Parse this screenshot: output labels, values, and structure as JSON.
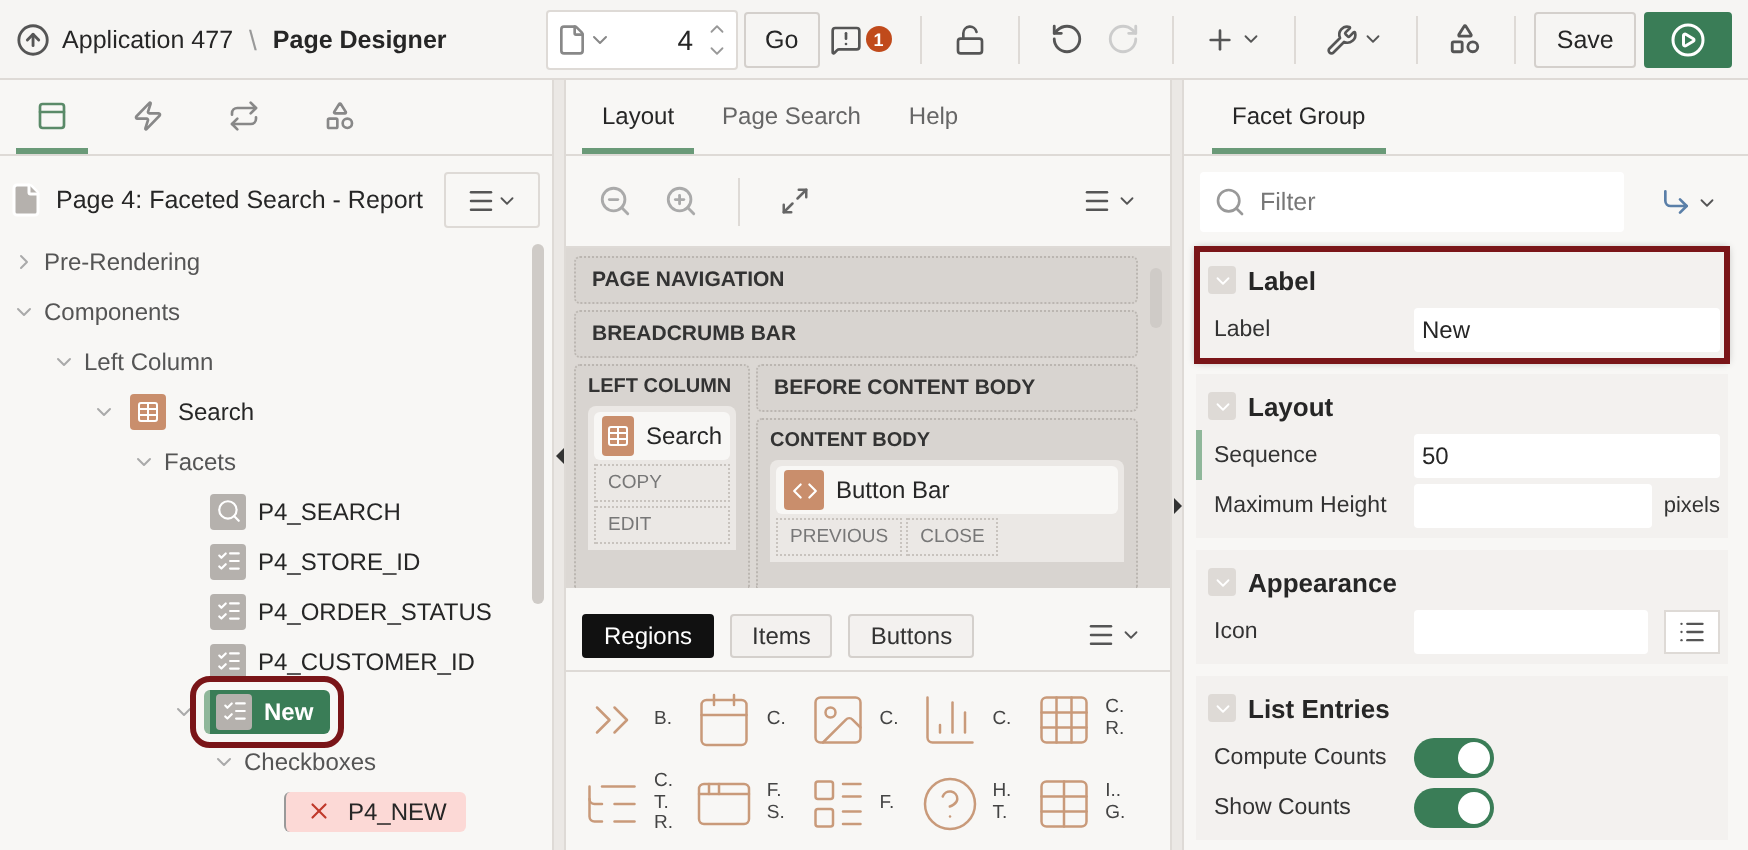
{
  "header": {
    "back_label": "Application 477",
    "separator": "\\",
    "title": "Page Designer",
    "page_number": "4",
    "go": "Go",
    "warning_count": "1",
    "redo_disabled": true,
    "save": "Save"
  },
  "left_panel": {
    "tabs": [
      {
        "kind": "rendering",
        "selected": true
      },
      {
        "kind": "dynamic",
        "selected": false
      },
      {
        "kind": "processing",
        "selected": false
      },
      {
        "kind": "shared",
        "selected": false
      }
    ],
    "page_title": "Page 4: Faceted Search - Report",
    "tree": [
      {
        "label": "Pre-Rendering",
        "expanded": false,
        "selected": false
      },
      {
        "label": "Components",
        "expanded": true,
        "selected": false,
        "children": [
          {
            "label": "Left Column",
            "expanded": true,
            "selected": false,
            "children": [
              {
                "label": "Search",
                "kind": "region",
                "expanded": true,
                "selected": false,
                "children": [
                  {
                    "label": "Facets",
                    "expanded": true,
                    "selected": false,
                    "children": [
                      {
                        "label": "P4_SEARCH",
                        "kind": "search",
                        "selected": false
                      },
                      {
                        "label": "P4_STORE_ID",
                        "kind": "checklist",
                        "selected": false
                      },
                      {
                        "label": "P4_ORDER_STATUS",
                        "kind": "checklist",
                        "selected": false
                      },
                      {
                        "label": "P4_CUSTOMER_ID",
                        "kind": "checklist",
                        "selected": false
                      },
                      {
                        "label": "New",
                        "kind": "checklist",
                        "expanded": true,
                        "selected": true,
                        "callout": true,
                        "children": [
                          {
                            "label": "Checkboxes",
                            "expanded": true,
                            "selected": false,
                            "children": [
                              {
                                "label": "P4_NEW",
                                "kind": "error",
                                "selected": false
                              }
                            ]
                          }
                        ]
                      }
                    ]
                  }
                ]
              }
            ]
          }
        ]
      }
    ]
  },
  "middle_panel": {
    "tabs": [
      {
        "label": "Layout",
        "selected": true
      },
      {
        "label": "Page Search",
        "selected": false
      },
      {
        "label": "Help",
        "selected": false
      }
    ],
    "layout": {
      "rows": [
        "PAGE NAVIGATION",
        "BREADCRUMB BAR"
      ],
      "left_column": {
        "title": "LEFT COLUMN",
        "region": {
          "title": "Search",
          "kind": "region",
          "buttons": [
            "COPY",
            "EDIT"
          ]
        }
      },
      "before_content": "BEFORE CONTENT BODY",
      "content_body": {
        "title": "CONTENT BODY",
        "region": {
          "title": "Button Bar",
          "kind": "code",
          "buttons": [
            "PREVIOUS",
            "CLOSE"
          ]
        }
      }
    },
    "gallery_tabs": [
      {
        "label": "Regions",
        "selected": true
      },
      {
        "label": "Items",
        "selected": false
      },
      {
        "label": "Buttons",
        "selected": false
      }
    ],
    "gallery": [
      {
        "kind": "chevrons",
        "lines": [
          "B."
        ]
      },
      {
        "kind": "calendar",
        "lines": [
          "C."
        ]
      },
      {
        "kind": "card",
        "lines": [
          "C."
        ]
      },
      {
        "kind": "bars",
        "lines": [
          "C."
        ]
      },
      {
        "kind": "grid",
        "lines": [
          "C.",
          "R."
        ]
      },
      {
        "kind": "tree",
        "lines": [
          "C.",
          "T.",
          "R."
        ]
      },
      {
        "kind": "frame",
        "lines": [
          "F.",
          "S."
        ]
      },
      {
        "kind": "form",
        "lines": [
          "F."
        ]
      },
      {
        "kind": "help",
        "lines": [
          "H.",
          "T."
        ]
      },
      {
        "kind": "igrid",
        "lines": [
          "I..",
          "G."
        ]
      }
    ]
  },
  "right_panel": {
    "tabs": [
      {
        "label": "Facet Group",
        "selected": true
      }
    ],
    "filter_placeholder": "Filter",
    "sections": [
      {
        "title": "Label",
        "callout": true,
        "fields": [
          {
            "kind": "text",
            "label": "Label",
            "value": "New"
          }
        ]
      },
      {
        "title": "Layout",
        "callout": false,
        "fields": [
          {
            "kind": "text",
            "label": "Sequence",
            "value": "50",
            "current": true
          },
          {
            "kind": "text",
            "label": "Maximum Height",
            "suffix": "pixels"
          }
        ]
      },
      {
        "title": "Appearance",
        "callout": false,
        "fields": [
          {
            "kind": "picker",
            "label": "Icon"
          }
        ]
      },
      {
        "title": "List Entries",
        "callout": false,
        "fields": [
          {
            "kind": "toggle",
            "label": "Compute Counts",
            "on": true
          },
          {
            "kind": "toggle",
            "label": "Show Counts",
            "on": true
          }
        ]
      }
    ]
  }
}
